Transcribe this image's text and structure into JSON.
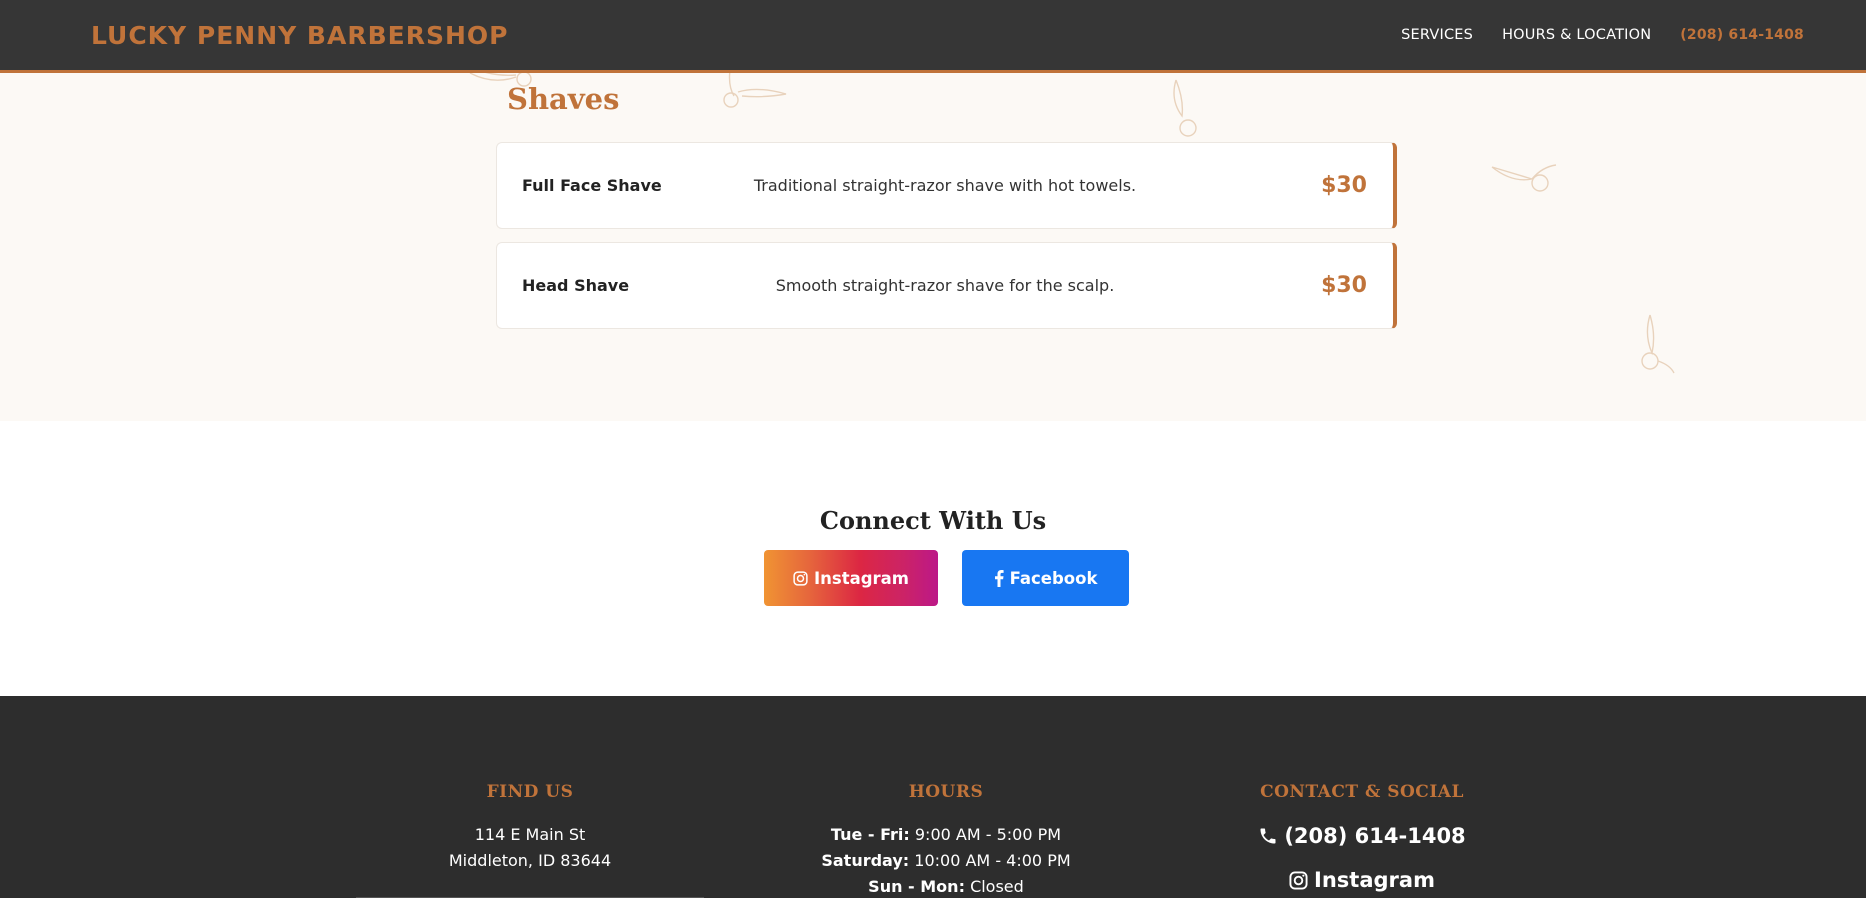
{
  "header": {
    "brand": "LUCKY PENNY BARBERSHOP",
    "nav": {
      "services": "SERVICES",
      "hours_location": "HOURS & LOCATION",
      "phone": "(208) 614-1408"
    }
  },
  "menu": {
    "section_title": "Shaves",
    "services": [
      {
        "name": "Full Face Shave",
        "description": "Traditional straight-razor shave with hot towels.",
        "price": "$30"
      },
      {
        "name": "Head Shave",
        "description": "Smooth straight-razor shave for the scalp.",
        "price": "$30"
      }
    ]
  },
  "connect": {
    "title": "Connect With Us",
    "instagram_label": "Instagram",
    "facebook_label": "Facebook"
  },
  "footer": {
    "find_us": {
      "heading": "FIND US",
      "address_line1": "114 E Main St",
      "address_line2": "Middleton, ID 83644"
    },
    "hours": {
      "heading": "HOURS",
      "rows": [
        {
          "days": "Tue - Fri:",
          "time": "9:00 AM - 5:00 PM"
        },
        {
          "days": "Saturday:",
          "time": "10:00 AM - 4:00 PM"
        },
        {
          "days": "Sun - Mon:",
          "time": "Closed"
        }
      ]
    },
    "contact": {
      "heading": "CONTACT & SOCIAL",
      "phone": "(208) 614-1408",
      "instagram": "Instagram"
    }
  },
  "colors": {
    "accent": "#c0733a",
    "header_bg": "#363636",
    "footer_bg": "#2d2d2d",
    "facebook_blue": "#1877f2"
  }
}
